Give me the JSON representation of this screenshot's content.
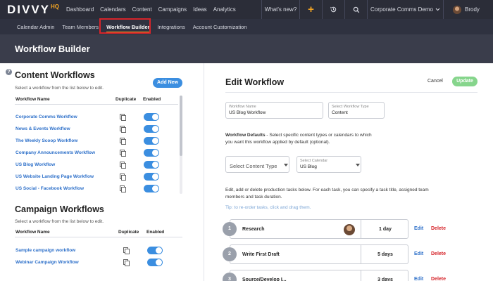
{
  "app": {
    "logo_text": "DIVVY",
    "logo_suffix": "HQ"
  },
  "topnav": {
    "links": [
      "Dashboard",
      "Calendars",
      "Content",
      "Campaigns",
      "Ideas",
      "Analytics"
    ],
    "whats_new": "What's new?",
    "plus_icon": "+",
    "history_icon": "history-icon",
    "search_icon": "search-icon",
    "org_selector": "Corporate Comms Demo",
    "user_name": "Brody"
  },
  "subnav": {
    "links": [
      "Calendar Admin",
      "Team Members",
      "Workflow Builder",
      "Integrations",
      "Account Customization"
    ],
    "active": "Workflow Builder"
  },
  "page": {
    "title": "Workflow Builder"
  },
  "content_workflows": {
    "title": "Content Workflows",
    "hint": "Select a workflow from the list below to edit.",
    "add_label": "Add New",
    "col_name": "Workflow Name",
    "col_duplicate": "Duplicate",
    "col_enabled": "Enabled",
    "items": [
      {
        "name": "Corporate Comms Workflow",
        "enabled": true
      },
      {
        "name": "News & Events Workflow",
        "enabled": true
      },
      {
        "name": "The Weekly Scoop Workflow",
        "enabled": true
      },
      {
        "name": "Company Announcements Workflow",
        "enabled": true
      },
      {
        "name": "US Blog Workflow",
        "enabled": true
      },
      {
        "name": "US Website Landing Page Workflow",
        "enabled": true
      },
      {
        "name": "US Social - Facebook Workflow",
        "enabled": true
      }
    ]
  },
  "campaign_workflows": {
    "title": "Campaign Workflows",
    "hint": "Select a workflow from the list below to edit.",
    "col_name": "Workflow Name",
    "col_duplicate": "Duplicate",
    "col_enabled": "Enabled",
    "items": [
      {
        "name": "Sample campaign workflow",
        "enabled": true
      },
      {
        "name": "Webinar Campaign Workflow",
        "enabled": true
      }
    ]
  },
  "edit": {
    "title": "Edit Workflow",
    "cancel_label": "Cancel",
    "update_label": "Update",
    "name_label": "Workflow Name",
    "name_value": "US Blog Workflow",
    "type_label": "Select Workflow Type",
    "type_value": "Content",
    "defaults_heading": "Workflow Defaults",
    "defaults_text_1": " - Select specific content types or calendars to which",
    "defaults_text_2": "you want this workflow applied by default (optional).",
    "content_type_placeholder": "Select Content Type",
    "calendar_label": "Select Calendar",
    "calendar_value": "US Blog",
    "tasks_text_1": "Edit, add or delete production tasks below. For each task, you can specify a task title, assigned team",
    "tasks_text_2": "members and task duration.",
    "tip": "Tip: to re-order tasks, click and drag them.",
    "edit_label": "Edit",
    "delete_label": "Delete",
    "tasks": [
      {
        "num": "1",
        "name": "Research",
        "duration": "1 day",
        "has_avatar": true
      },
      {
        "num": "2",
        "name": "Write First Draft",
        "duration": "5 days",
        "has_avatar": false
      },
      {
        "num": "3",
        "name": "Source/Develop I...",
        "duration": "3 days",
        "has_avatar": false
      }
    ]
  }
}
